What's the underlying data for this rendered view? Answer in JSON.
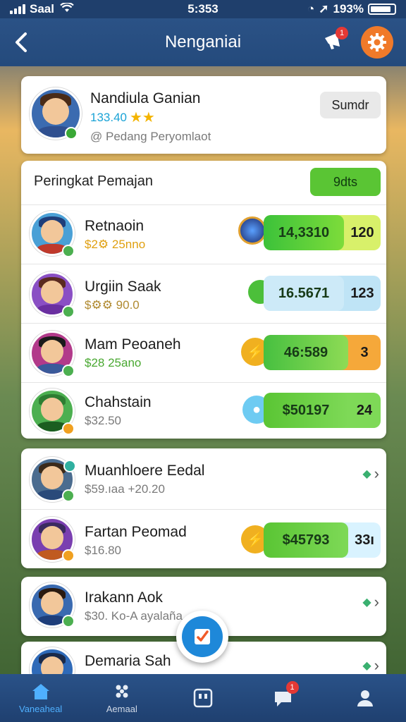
{
  "status_bar": {
    "carrier": "Saal",
    "time": "5:353",
    "battery": "193%"
  },
  "nav": {
    "title": "Nenganiai",
    "notification_count": "1"
  },
  "profile": {
    "name": "Nandiula Ganian",
    "score": "133.40",
    "subtitle": "@ Pedang Peryomlaot",
    "button_label": "Sumdr"
  },
  "leaderboard": {
    "title": "Peringkat Pemajan",
    "button_label": "9dts",
    "rows": [
      {
        "name": "Retnaoin",
        "sub": "$2⚙ 25nno",
        "score": "14,3310",
        "rank": "120"
      },
      {
        "name": "Urgiin Saak",
        "sub": "$⚙⚙ 90.0",
        "score": "16.5671",
        "rank": "123"
      },
      {
        "name": "Mam Peoaneh",
        "sub": "$28 25ano",
        "score": "46:589",
        "rank": "3"
      },
      {
        "name": "Chahstain",
        "sub": "$32.50",
        "score": "$50197",
        "rank": "24"
      }
    ]
  },
  "list2": {
    "rows": [
      {
        "name": "Muanhloere Eedal",
        "sub": "$59.ıaa +20.20"
      },
      {
        "name": "Fartan Peomad",
        "sub": "$16.80",
        "score": "$45793",
        "rank": "33ı"
      }
    ]
  },
  "list3": {
    "rows": [
      {
        "name": "Irakann Aok",
        "sub": "$30. Ko-A ayalaña..."
      },
      {
        "name": "Demaria Sah",
        "sub": ""
      }
    ]
  },
  "tabs": [
    {
      "label": "Vaneaheal",
      "icon": "home-icon"
    },
    {
      "label": "Aemaal",
      "icon": "grid-icon"
    },
    {
      "label": "",
      "icon": "board-icon"
    },
    {
      "label": "",
      "icon": "chat-icon",
      "badge": "1"
    },
    {
      "label": "",
      "icon": "profile-icon"
    }
  ],
  "colors": {
    "primary_nav": "#2b5286",
    "accent_orange": "#f07a2a",
    "green": "#5ac534",
    "blue_fab": "#1e88d9"
  }
}
